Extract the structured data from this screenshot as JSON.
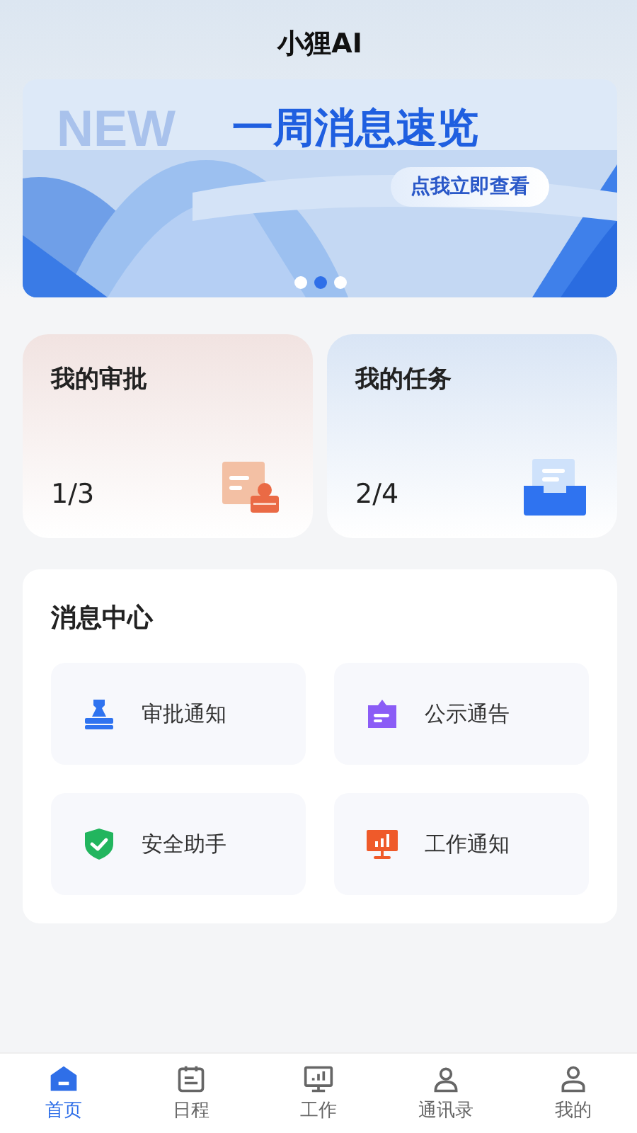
{
  "header": {
    "title": "小狸AI"
  },
  "banner": {
    "tag": "NEW",
    "headline": "一周消息速览",
    "button": "点我立即查看",
    "dots": [
      {
        "selected": false
      },
      {
        "selected": true
      },
      {
        "selected": false
      }
    ]
  },
  "summary_cards": [
    {
      "kind": "approval",
      "title": "我的审批",
      "count": "1/3"
    },
    {
      "kind": "task",
      "title": "我的任务",
      "count": "2/4"
    }
  ],
  "message_center": {
    "title": "消息中心",
    "items": [
      {
        "kind": "stamp",
        "label": "审批通知"
      },
      {
        "kind": "notice",
        "label": "公示通告"
      },
      {
        "kind": "shield",
        "label": "安全助手"
      },
      {
        "kind": "monitor",
        "label": "工作通知"
      }
    ]
  },
  "tab_bar": [
    {
      "kind": "home",
      "label": "首页",
      "selected": true
    },
    {
      "kind": "calendar",
      "label": "日程",
      "selected": false
    },
    {
      "kind": "work",
      "label": "工作",
      "selected": false
    },
    {
      "kind": "contacts",
      "label": "通讯录",
      "selected": false
    },
    {
      "kind": "me",
      "label": "我的",
      "selected": false
    }
  ]
}
